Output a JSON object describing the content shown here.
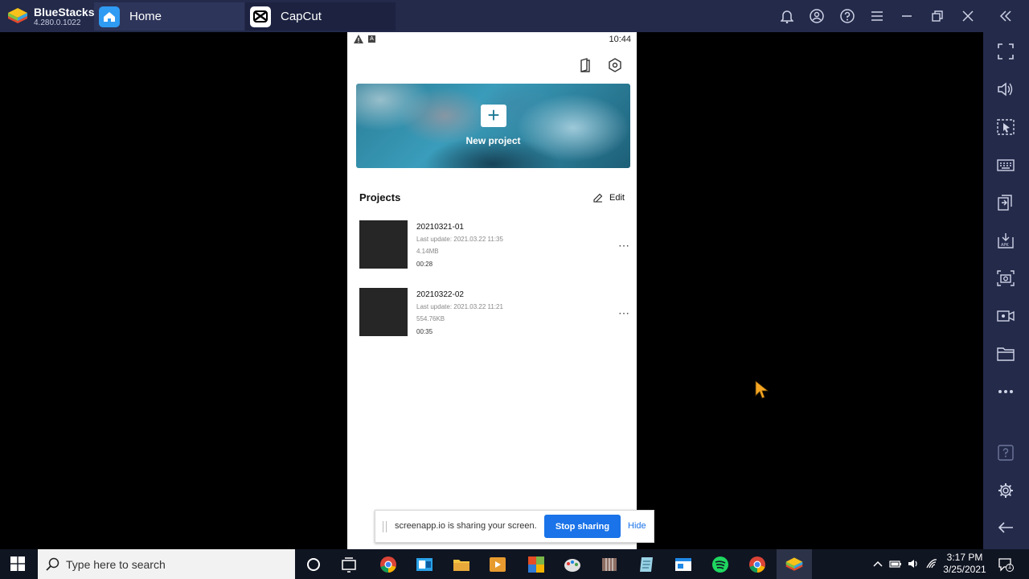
{
  "bluestacks": {
    "name": "BlueStacks",
    "version": "4.280.0.1022"
  },
  "tabs": [
    {
      "label": "Home"
    },
    {
      "label": "CapCut"
    }
  ],
  "phone": {
    "status_time": "10:44",
    "status_badge": "A",
    "new_project_label": "New project",
    "projects_title": "Projects",
    "edit_label": "Edit",
    "projects": [
      {
        "name": "20210321-01",
        "last_update": "Last update: 2021.03.22 11:35",
        "size": "4.14MB",
        "duration": "00:28",
        "more": "⋯"
      },
      {
        "name": "20210322-02",
        "last_update": "Last update: 2021.03.22 11:21",
        "size": "554.76KB",
        "duration": "00:35",
        "more": "⋯"
      }
    ]
  },
  "sharebar": {
    "message": "screenapp.io is sharing your screen.",
    "stop_label": "Stop sharing",
    "hide_label": "Hide"
  },
  "taskbar": {
    "search_placeholder": "Type here to search",
    "time": "3:17 PM",
    "date": "3/25/2021",
    "notification_count": "1"
  },
  "colors": {
    "bluestacks_bar": "#232a4a",
    "share_button": "#1a73e8",
    "taskbar": "#101522"
  }
}
